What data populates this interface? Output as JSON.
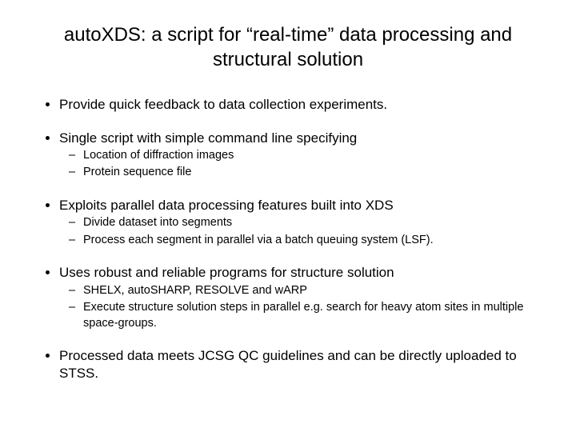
{
  "title": "autoXDS: a script for “real-time” data processing and structural solution",
  "bullets": [
    {
      "text": "Provide quick feedback to data collection experiments.",
      "sub": []
    },
    {
      "text": "Single script with simple command line specifying",
      "sub": [
        "Location of diffraction images",
        "Protein sequence file"
      ]
    },
    {
      "text": "Exploits parallel data processing features built into XDS",
      "sub": [
        "Divide dataset into segments",
        "Process each segment in parallel via a batch queuing system (LSF)."
      ]
    },
    {
      "text": "Uses robust and reliable programs for structure solution",
      "sub": [
        "SHELX, autoSHARP, RESOLVE and wARP",
        "Execute structure solution steps in parallel e.g. search for heavy atom sites in multiple space-groups."
      ]
    },
    {
      "text": "Processed data meets JCSG QC guidelines and can be directly uploaded to STSS.",
      "sub": []
    }
  ]
}
